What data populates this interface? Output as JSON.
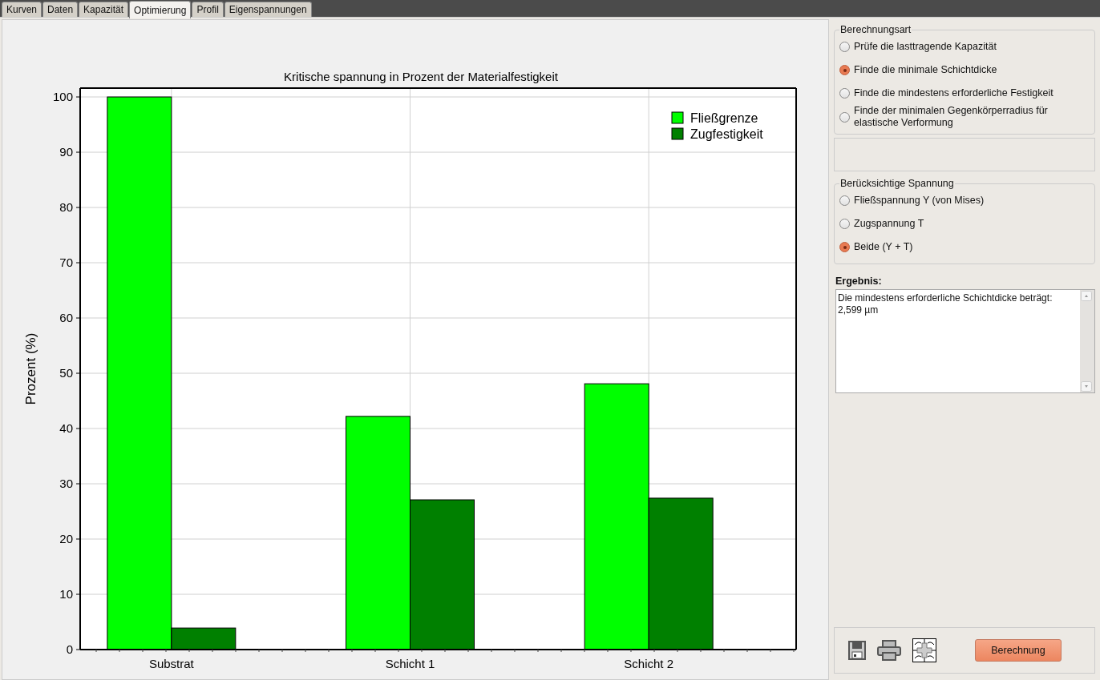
{
  "tabs": [
    {
      "label": "Kurven",
      "selected": false
    },
    {
      "label": "Daten",
      "selected": false
    },
    {
      "label": "Kapazität",
      "selected": false
    },
    {
      "label": "Optimierung",
      "selected": true
    },
    {
      "label": "Profil",
      "selected": false
    },
    {
      "label": "Eigenspannungen",
      "selected": false
    }
  ],
  "chart": {
    "chart_data": {
      "type": "bar",
      "title": "Kritische spannung in Prozent der Materialfestigkeit",
      "ylabel": "Prozent (%)",
      "categories": [
        "Substrat",
        "Schicht 1",
        "Schicht 2"
      ],
      "series": [
        {
          "name": "Fließgrenze",
          "color": "#00ff00",
          "values": [
            100,
            42.2,
            48.1
          ]
        },
        {
          "name": "Zugfestigkeit",
          "color": "#008000",
          "values": [
            3.9,
            27.1,
            27.4
          ]
        }
      ],
      "ylim": [
        0,
        101.6
      ],
      "grid": true,
      "legend": true,
      "yticks": [
        0,
        10,
        20,
        30,
        40,
        50,
        60,
        70,
        80,
        90,
        100
      ]
    }
  },
  "berechnungsart": {
    "title": "Berechnungsart",
    "options": [
      {
        "label": "Prüfe die lasttragende Kapazität",
        "selected": false
      },
      {
        "label": "Finde die minimale Schichtdicke",
        "selected": true
      },
      {
        "label": "Finde die mindestens erforderliche Festigkeit",
        "selected": false
      },
      {
        "label": "Finde der minimalen Gegenkörperradius für elastische Verformung",
        "selected": false
      }
    ]
  },
  "spannung": {
    "title": "Berücksichtige Spannung",
    "options": [
      {
        "label": "Fließspannung Y (von Mises)",
        "selected": false
      },
      {
        "label": "Zugspannung T",
        "selected": false
      },
      {
        "label": "Beide (Y + T)",
        "selected": true
      }
    ]
  },
  "ergebnis": {
    "label": "Ergebnis:",
    "lines": [
      "Die mindestens erforderliche Schichtdicke beträgt:",
      "2,599 µm"
    ]
  },
  "calc_button": "Berechnung"
}
